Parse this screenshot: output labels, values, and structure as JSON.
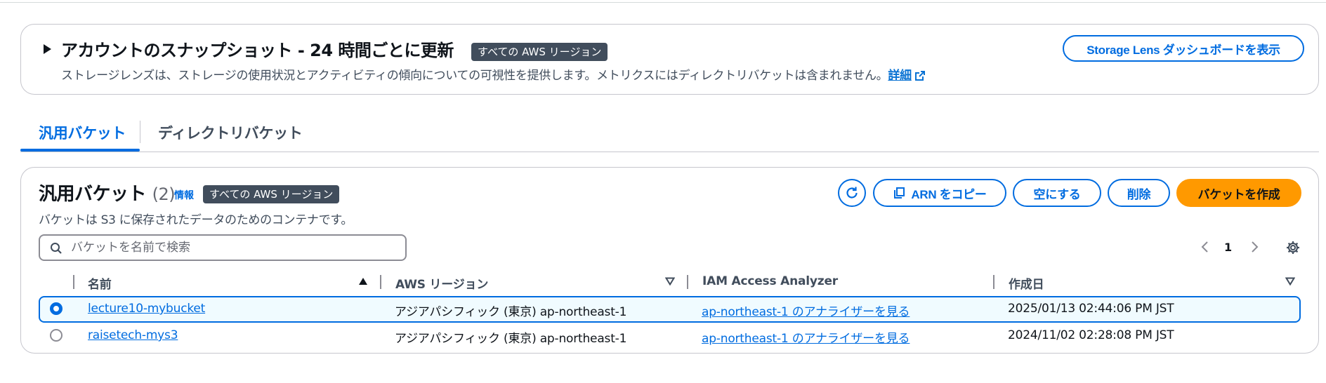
{
  "snapshot": {
    "title": "アカウントのスナップショット - 24 時間ごとに更新",
    "badge": "すべての AWS リージョン",
    "description": "ストレージレンズは、ストレージの使用状況とアクティビティの傾向についての可視性を提供します。メトリクスにはディレクトリバケットは含まれません。",
    "details_link": "詳細",
    "storage_lens_button": "Storage Lens ダッシュボードを表示"
  },
  "tabs": [
    {
      "label": "汎用バケット",
      "active": true
    },
    {
      "label": "ディレクトリバケット",
      "active": false
    }
  ],
  "buckets_panel": {
    "title": "汎用バケット",
    "count": "(2)",
    "info_link": "情報",
    "badge": "すべての AWS リージョン",
    "description": "バケットは S3 に保存されたデータのためのコンテナです。",
    "buttons": {
      "refresh": "refresh-icon",
      "copy_arn": "ARN をコピー",
      "empty": "空にする",
      "delete": "削除",
      "create": "バケットを作成"
    },
    "search": {
      "placeholder": "バケットを名前で検索",
      "value": ""
    },
    "pagination": {
      "current_page": "1"
    },
    "columns": [
      "名前",
      "AWS リージョン",
      "IAM Access Analyzer",
      "作成日"
    ],
    "rows": [
      {
        "selected": true,
        "name": "lecture10-mybucket",
        "region": "アジアパシフィック (東京) ap-northeast-1",
        "analyzer": "ap-northeast-1 のアナライザーを見る",
        "created": "2025/01/13 02:44:06 PM JST"
      },
      {
        "selected": false,
        "name": "raisetech-mys3",
        "region": "アジアパシフィック (東京) ap-northeast-1",
        "analyzer": "ap-northeast-1 のアナライザーを見る",
        "created": "2024/11/02 02:28:08 PM JST"
      }
    ]
  },
  "colors": {
    "primary": "#006ce0",
    "create_button": "#ff9900",
    "badge_bg": "#414d5c",
    "selected_row_bg": "#f0fbff"
  }
}
